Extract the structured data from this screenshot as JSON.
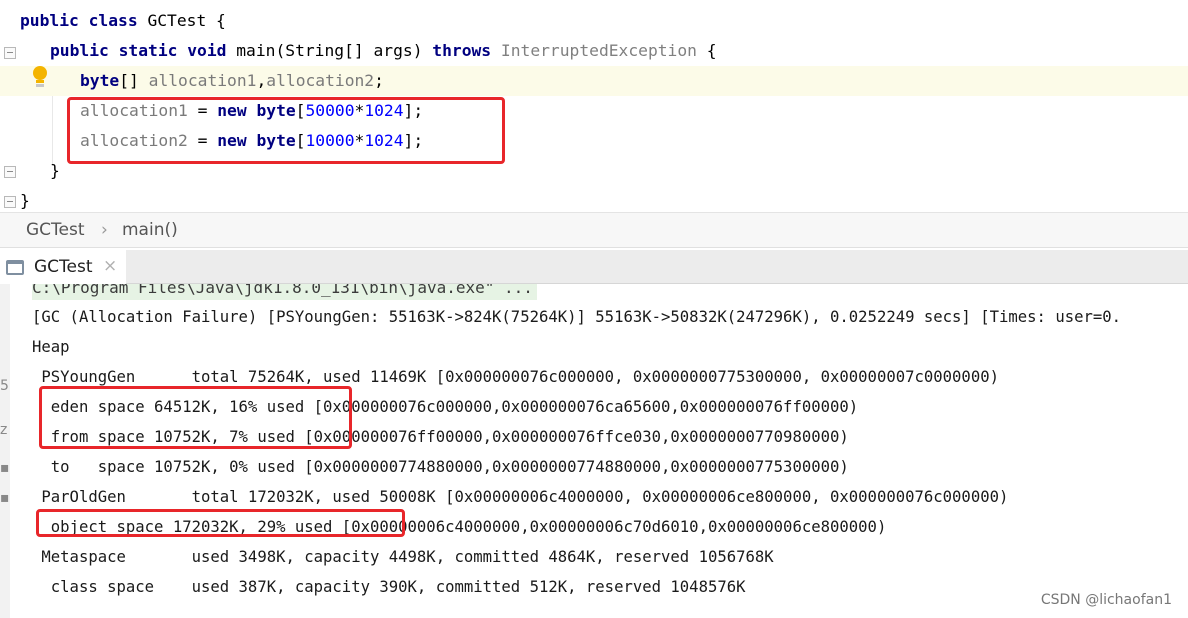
{
  "editor": {
    "lines": [
      {
        "tokens": [
          [
            "kw",
            "public class "
          ],
          [
            "plain",
            "GCTest {"
          ]
        ]
      },
      {
        "tokens": [
          [
            "kw",
            "public static void "
          ],
          [
            "plain",
            "main(String[] args) "
          ],
          [
            "kw",
            "throws "
          ],
          [
            "ann",
            "InterruptedException "
          ],
          [
            "plain",
            "{"
          ]
        ]
      },
      {
        "tokens": [
          [
            "kw",
            "byte"
          ],
          [
            "plain",
            "[] "
          ],
          [
            "var",
            "allocation1"
          ],
          [
            "plain",
            ","
          ],
          [
            "var",
            "allocation2"
          ],
          [
            "plain",
            ";"
          ]
        ]
      },
      {
        "tokens": [
          [
            "var",
            "allocation1"
          ],
          [
            "plain",
            " = "
          ],
          [
            "kw",
            "new byte"
          ],
          [
            "plain",
            "["
          ],
          [
            "num",
            "50000"
          ],
          [
            "plain",
            "*"
          ],
          [
            "num",
            "1024"
          ],
          [
            "plain",
            "];"
          ]
        ]
      },
      {
        "tokens": [
          [
            "var",
            "allocation2"
          ],
          [
            "plain",
            " = "
          ],
          [
            "kw",
            "new byte"
          ],
          [
            "plain",
            "["
          ],
          [
            "num",
            "10000"
          ],
          [
            "plain",
            "*"
          ],
          [
            "num",
            "1024"
          ],
          [
            "plain",
            "];"
          ]
        ]
      },
      {
        "tokens": [
          [
            "plain",
            "}"
          ]
        ]
      },
      {
        "tokens": [
          [
            "plain",
            "}"
          ]
        ]
      }
    ]
  },
  "breadcrumb": {
    "items": [
      "GCTest",
      "main()"
    ],
    "separator": "›"
  },
  "run_panel": {
    "tab_label": "GCTest",
    "close_glyph": "×"
  },
  "console": {
    "command_line": "C:\\Program Files\\Java\\jdk1.8.0_131\\bin\\java.exe\" ...",
    "lines": [
      "[GC (Allocation Failure) [PSYoungGen: 55163K->824K(75264K)] 55163K->50832K(247296K), 0.0252249 secs] [Times: user=0.",
      "Heap",
      " PSYoungGen      total 75264K, used 11469K [0x000000076c000000, 0x0000000775300000, 0x00000007c0000000)",
      "  eden space 64512K, 16% used [0x000000076c000000,0x000000076ca65600,0x000000076ff00000)",
      "  from space 10752K, 7% used [0x000000076ff00000,0x000000076ffce030,0x0000000770980000)",
      "  to   space 10752K, 0% used [0x0000000774880000,0x0000000774880000,0x0000000775300000)",
      " ParOldGen       total 172032K, used 50008K [0x00000006c4000000, 0x00000006ce800000, 0x000000076c000000)",
      "  object space 172032K, 29% used [0x00000006c4000000,0x00000006c70d6010,0x00000006ce800000)",
      " Metaspace       used 3498K, capacity 4498K, committed 4864K, reserved 1056768K",
      "  class space    used 387K, capacity 390K, committed 512K, reserved 1048576K"
    ],
    "side_marks": [
      "5",
      "z",
      "▪",
      "▪"
    ]
  },
  "watermark": "CSDN @lichaofan1",
  "colors": {
    "keyword": "#000080",
    "variable": "#7a7a7a",
    "number": "#0000ff",
    "annotation_box": "#e8262a",
    "current_line": "#fcfbe8"
  }
}
